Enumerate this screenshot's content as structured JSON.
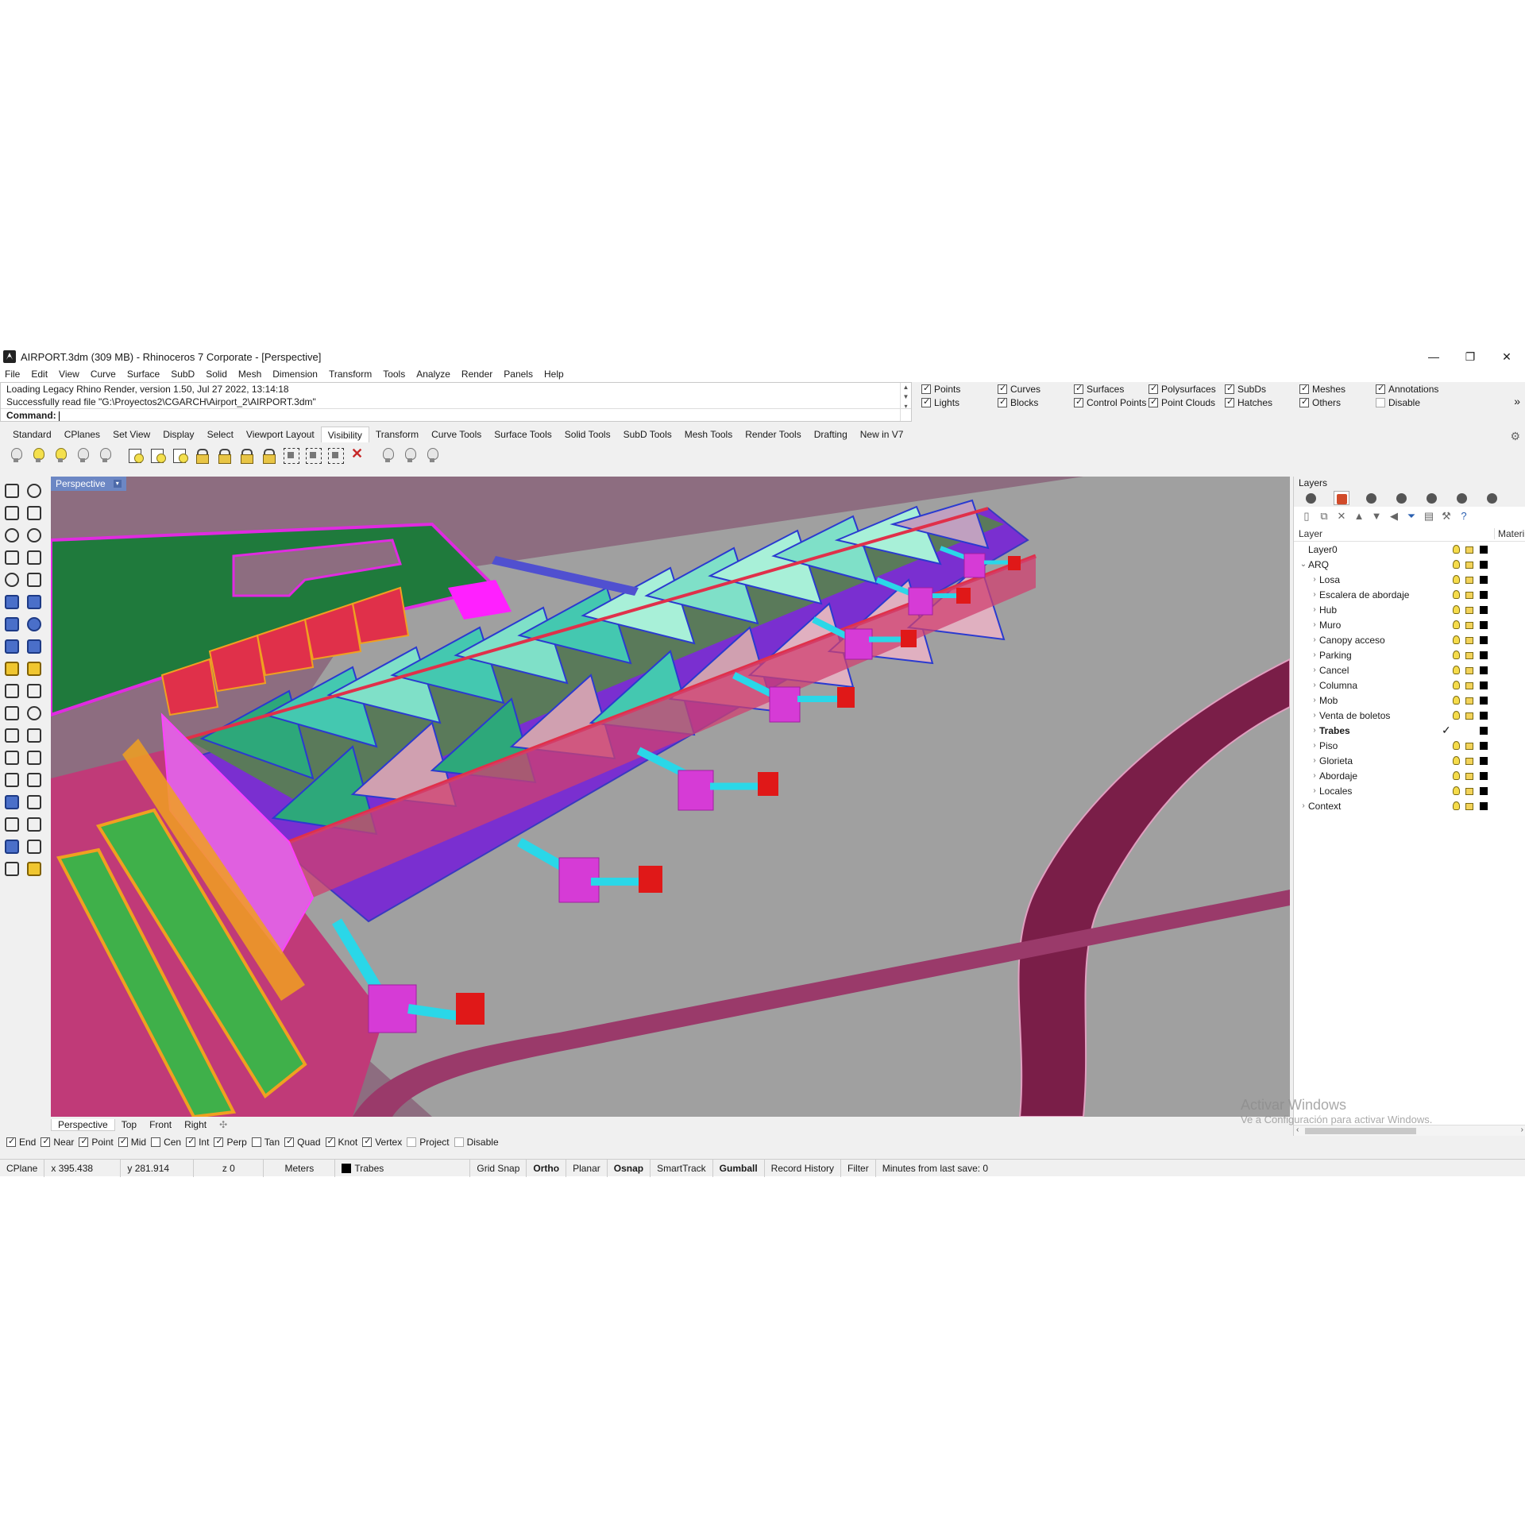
{
  "window": {
    "title": "AIRPORT.3dm (309 MB) - Rhinoceros 7 Corporate - [Perspective]",
    "minimize": "—",
    "maximize": "❐",
    "close": "✕"
  },
  "menu": [
    "File",
    "Edit",
    "View",
    "Curve",
    "Surface",
    "SubD",
    "Solid",
    "Mesh",
    "Dimension",
    "Transform",
    "Tools",
    "Analyze",
    "Render",
    "Panels",
    "Help"
  ],
  "command": {
    "history": [
      "Loading Legacy Rhino Render, version 1.50, Jul 27 2022, 13:14:18",
      "Successfully read file \"G:\\Proyectos2\\CGARCH\\Airport_2\\AIRPORT.3dm\""
    ],
    "prompt": "Command:"
  },
  "selection_filter": [
    {
      "label": "Points",
      "checked": true
    },
    {
      "label": "Curves",
      "checked": true
    },
    {
      "label": "Surfaces",
      "checked": true
    },
    {
      "label": "Polysurfaces",
      "checked": true
    },
    {
      "label": "SubDs",
      "checked": true
    },
    {
      "label": "Meshes",
      "checked": true
    },
    {
      "label": "Annotations",
      "checked": true
    },
    {
      "label": "Lights",
      "checked": true
    },
    {
      "label": "Blocks",
      "checked": true
    },
    {
      "label": "Control Points",
      "checked": true
    },
    {
      "label": "Point Clouds",
      "checked": true
    },
    {
      "label": "Hatches",
      "checked": true
    },
    {
      "label": "Others",
      "checked": true
    },
    {
      "label": "Disable",
      "checked": false
    }
  ],
  "toolbar_tabs": [
    "Standard",
    "CPlanes",
    "Set View",
    "Display",
    "Select",
    "Viewport Layout",
    "Visibility",
    "Transform",
    "Curve Tools",
    "Surface Tools",
    "Solid Tools",
    "SubD Tools",
    "Mesh Tools",
    "Render Tools",
    "Drafting",
    "New in V7"
  ],
  "active_tab": "Visibility",
  "viewport": {
    "title": "Perspective",
    "dropdown": "▾"
  },
  "viewport_tabs": [
    "Perspective",
    "Top",
    "Front",
    "Right"
  ],
  "viewport_tab_add": "✣",
  "osnaps": [
    {
      "label": "End",
      "checked": true
    },
    {
      "label": "Near",
      "checked": true
    },
    {
      "label": "Point",
      "checked": true
    },
    {
      "label": "Mid",
      "checked": true
    },
    {
      "label": "Cen",
      "checked": false
    },
    {
      "label": "Int",
      "checked": true
    },
    {
      "label": "Perp",
      "checked": true
    },
    {
      "label": "Tan",
      "checked": false
    },
    {
      "label": "Quad",
      "checked": true
    },
    {
      "label": "Knot",
      "checked": true
    },
    {
      "label": "Vertex",
      "checked": true
    },
    {
      "label": "Project",
      "checked": false
    },
    {
      "label": "Disable",
      "checked": false
    }
  ],
  "status": {
    "cplane": "CPlane",
    "x": "x 395.438",
    "y": "y 281.914",
    "z": "z 0",
    "units": "Meters",
    "layer": "Trabes",
    "toggles": [
      "Grid Snap",
      "Ortho",
      "Planar",
      "Osnap",
      "SmartTrack",
      "Gumball",
      "Record History",
      "Filter"
    ],
    "bold_toggles": [
      "Ortho",
      "Osnap",
      "Gumball"
    ],
    "save_info": "Minutes from last save: 0"
  },
  "layers_panel": {
    "title": "Layers",
    "col_layer": "Layer",
    "col_material": "Materi",
    "rows": [
      {
        "name": "Layer0",
        "indent": 0,
        "arrow": "",
        "current": false
      },
      {
        "name": "ARQ",
        "indent": 0,
        "arrow": "⌄",
        "current": false
      },
      {
        "name": "Losa",
        "indent": 1,
        "arrow": "›",
        "current": false
      },
      {
        "name": "Escalera de abordaje",
        "indent": 1,
        "arrow": "›",
        "current": false
      },
      {
        "name": "Hub",
        "indent": 1,
        "arrow": "›",
        "current": false
      },
      {
        "name": "Muro",
        "indent": 1,
        "arrow": "›",
        "current": false
      },
      {
        "name": "Canopy acceso",
        "indent": 1,
        "arrow": "›",
        "current": false
      },
      {
        "name": "Parking",
        "indent": 1,
        "arrow": "›",
        "current": false
      },
      {
        "name": "Cancel",
        "indent": 1,
        "arrow": "›",
        "current": false
      },
      {
        "name": "Columna",
        "indent": 1,
        "arrow": "›",
        "current": false
      },
      {
        "name": "Mob",
        "indent": 1,
        "arrow": "›",
        "current": false
      },
      {
        "name": "Venta de boletos",
        "indent": 1,
        "arrow": "›",
        "current": false
      },
      {
        "name": "Trabes",
        "indent": 1,
        "arrow": "›",
        "current": true
      },
      {
        "name": "Piso",
        "indent": 1,
        "arrow": "›",
        "current": false
      },
      {
        "name": "Glorieta",
        "indent": 1,
        "arrow": "›",
        "current": false
      },
      {
        "name": "Abordaje",
        "indent": 1,
        "arrow": "›",
        "current": false
      },
      {
        "name": "Locales",
        "indent": 1,
        "arrow": "›",
        "current": false
      },
      {
        "name": "Context",
        "indent": 0,
        "arrow": "›",
        "current": false
      }
    ]
  },
  "watermark": {
    "line1": "Activar Windows",
    "line2": "Ve a Configuración para activar Windows."
  },
  "colors": {
    "viewport_title": "#6c87c4",
    "ground": "#9a9a9a",
    "roof_teal": "#3fd9d0",
    "structure_red": "#e0304a",
    "bridge_cyan": "#2ad7e8",
    "hub_magenta": "#d63bd6"
  }
}
